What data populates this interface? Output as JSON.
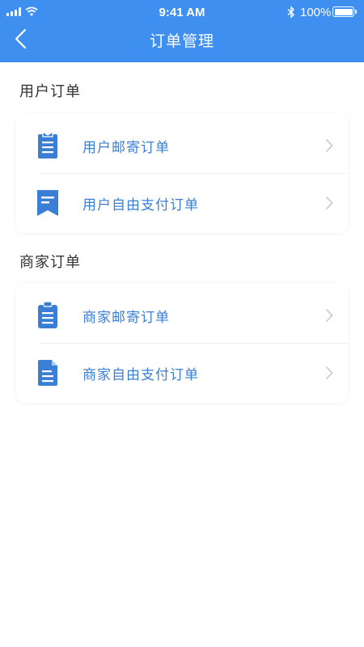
{
  "status_bar": {
    "time": "9:41 AM",
    "battery": "100%"
  },
  "header": {
    "title": "订单管理",
    "back_icon": "chevron-left-icon"
  },
  "sections": [
    {
      "title": "用户订单",
      "items": [
        {
          "label": "用户邮寄订单",
          "icon": "clipboard-list-icon"
        },
        {
          "label": "用户自由支付订单",
          "icon": "bookmark-doc-icon"
        }
      ]
    },
    {
      "title": "商家订单",
      "items": [
        {
          "label": "商家邮寄订单",
          "icon": "clipboard-icon"
        },
        {
          "label": "商家自由支付订单",
          "icon": "document-icon"
        }
      ]
    }
  ],
  "colors": {
    "primary": "#3f8ff0",
    "label": "#3a7fd5",
    "icon": "#3a7fd5"
  }
}
